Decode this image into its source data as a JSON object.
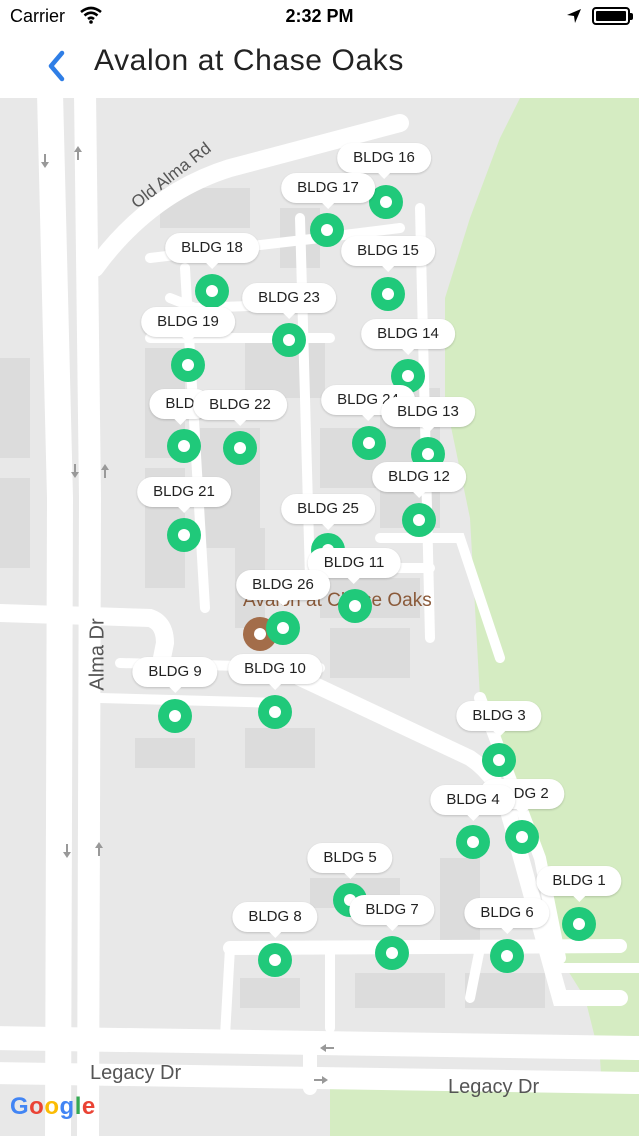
{
  "status_bar": {
    "carrier": "Carrier",
    "time": "2:32 PM"
  },
  "nav": {
    "title": "Avalon at Chase Oaks"
  },
  "map": {
    "poi_label": "Avalon at Chase Oaks",
    "road_labels": {
      "old_alma": "Old Alma Rd",
      "alma": "Alma Dr",
      "legacy_1": "Legacy Dr",
      "legacy_2": "Legacy Dr"
    },
    "google": [
      "G",
      "o",
      "o",
      "g",
      "l",
      "e"
    ],
    "google_colors": [
      "#4285F4",
      "#EA4335",
      "#FBBC05",
      "#4285F4",
      "#34A853",
      "#EA4335"
    ],
    "accent": "#20c97a",
    "park_color": "#d5ecc2",
    "buildings": [
      {
        "label": "BLDG 16"
      },
      {
        "label": "BLDG 17"
      },
      {
        "label": "BLDG 15"
      },
      {
        "label": "BLDG 18"
      },
      {
        "label": "BLDG 23"
      },
      {
        "label": "BLDG 19"
      },
      {
        "label": "BLDG 14"
      },
      {
        "label": "BLD"
      },
      {
        "label": "BLDG 22"
      },
      {
        "label": "BLDG 24"
      },
      {
        "label": "BLDG 13"
      },
      {
        "label": "BLDG 12"
      },
      {
        "label": "BLDG 21"
      },
      {
        "label": "BLDG 25"
      },
      {
        "label": "BLDG 11"
      },
      {
        "label": "BLDG 26"
      },
      {
        "label": "BLDG 9"
      },
      {
        "label": "BLDG 10"
      },
      {
        "label": "BLDG 3"
      },
      {
        "label": "BLDG 2"
      },
      {
        "label": "BLDG 4"
      },
      {
        "label": "BLDG 5"
      },
      {
        "label": "BLDG 1"
      },
      {
        "label": "BLDG 8"
      },
      {
        "label": "BLDG 7"
      },
      {
        "label": "BLDG 6"
      }
    ]
  }
}
